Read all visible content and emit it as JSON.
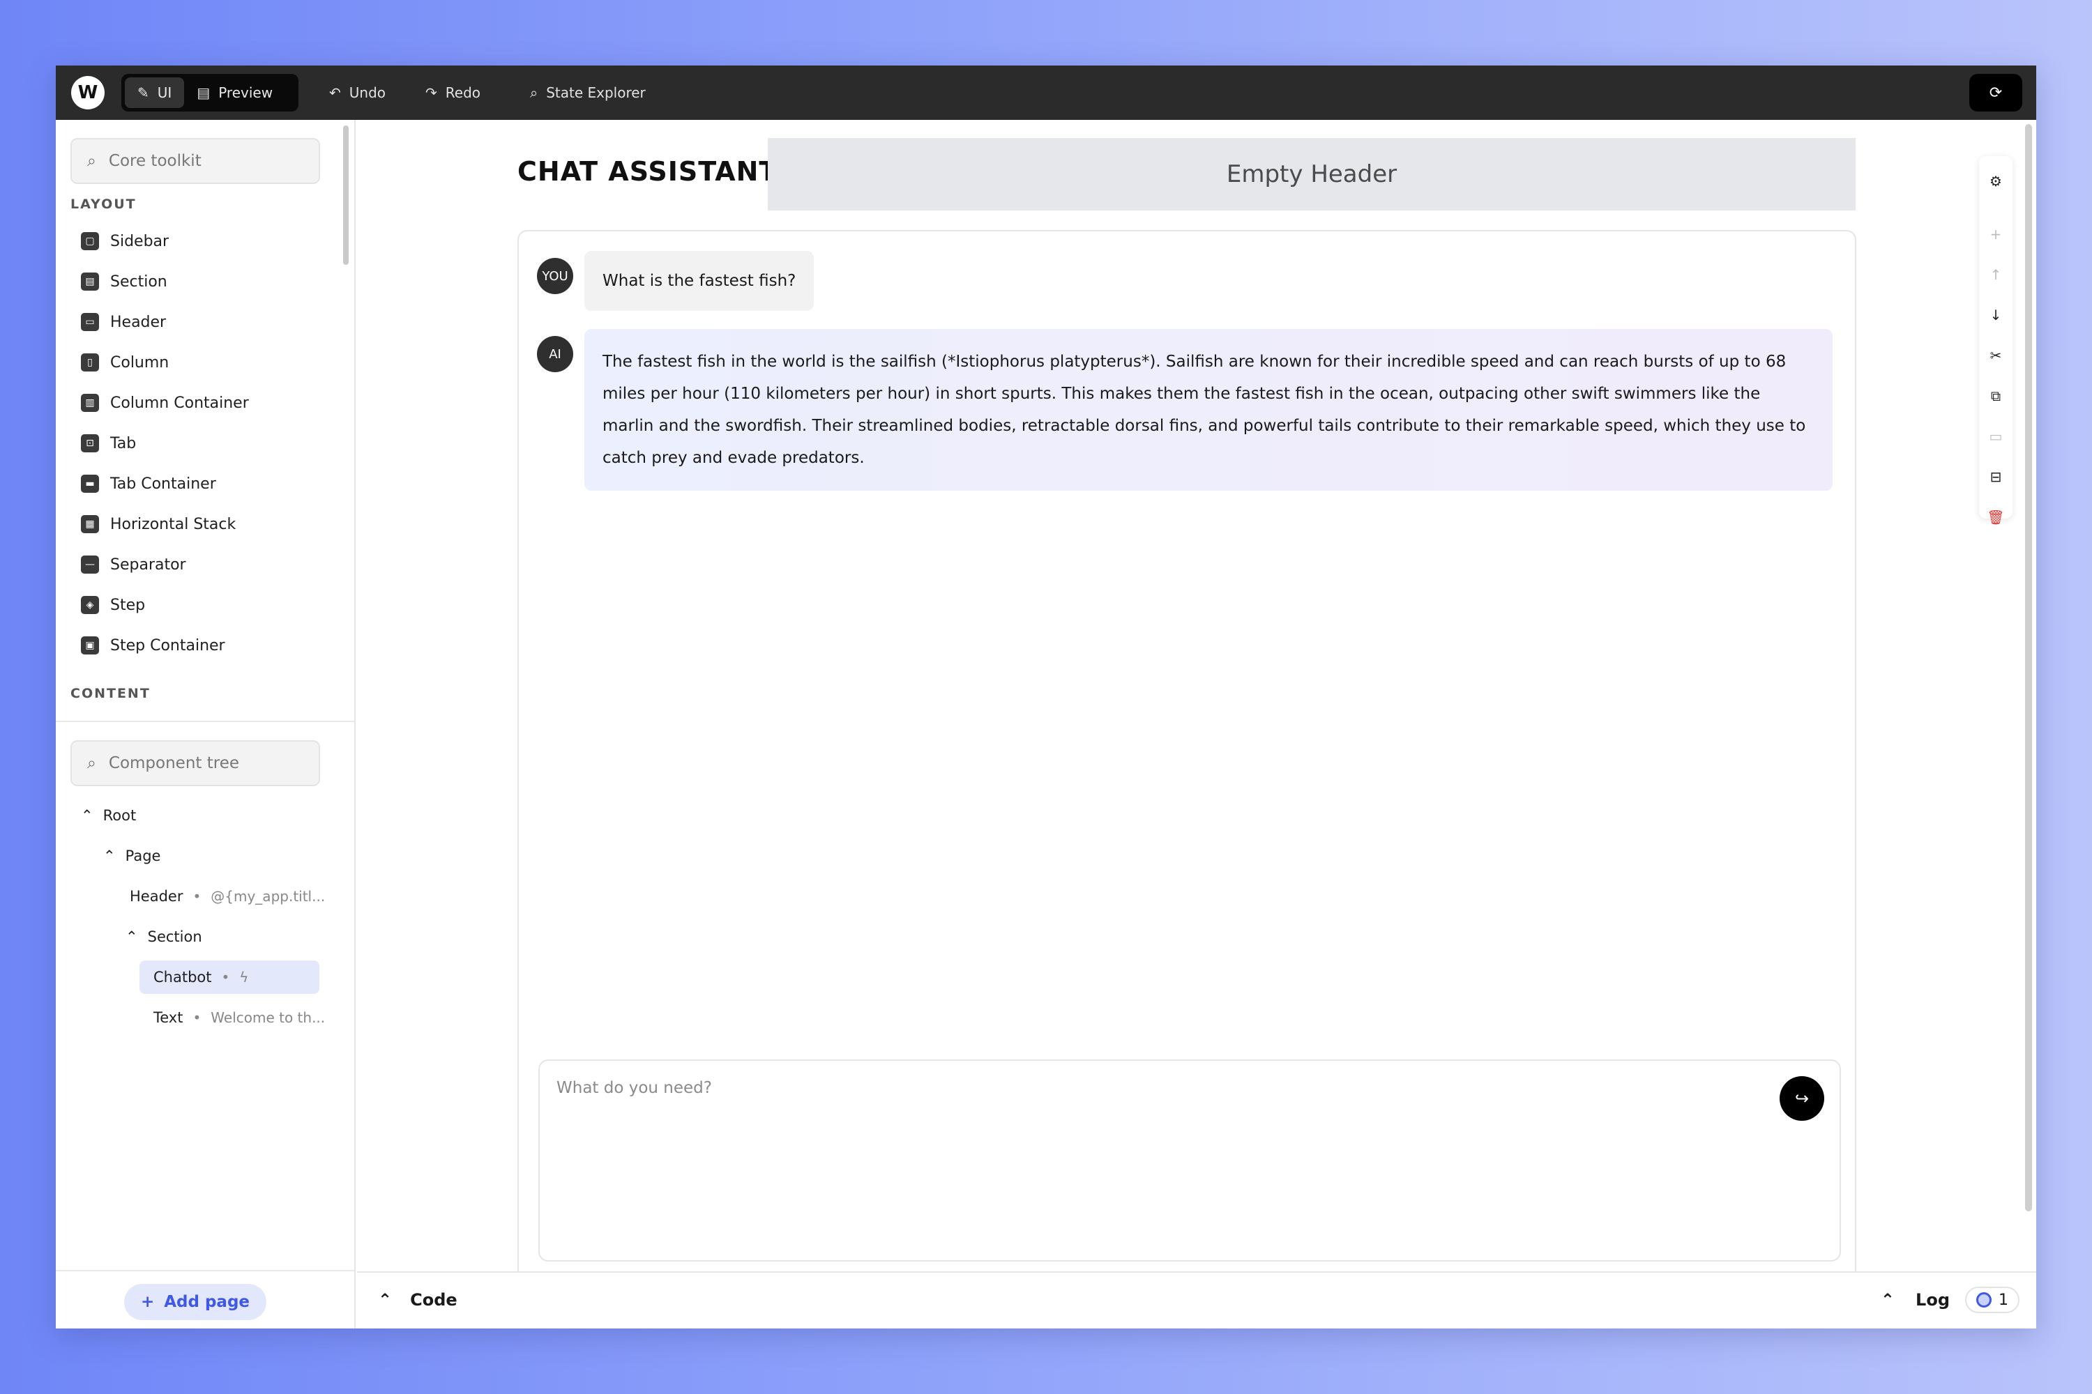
{
  "topbar": {
    "logo": "W",
    "modes": [
      {
        "label": "UI",
        "icon": "pencil-icon",
        "active": true
      },
      {
        "label": "Preview",
        "icon": "preview-icon",
        "active": false
      }
    ],
    "undo_label": "Undo",
    "redo_label": "Redo",
    "state_explorer_label": "State Explorer"
  },
  "sidebar": {
    "toolkit_search_placeholder": "Core toolkit",
    "layout_label": "LAYOUT",
    "layout_items": [
      {
        "label": "Sidebar",
        "icon": "sidebar-icon"
      },
      {
        "label": "Section",
        "icon": "section-icon"
      },
      {
        "label": "Header",
        "icon": "header-icon"
      },
      {
        "label": "Column",
        "icon": "column-icon"
      },
      {
        "label": "Column Container",
        "icon": "column-container-icon"
      },
      {
        "label": "Tab",
        "icon": "tab-icon"
      },
      {
        "label": "Tab Container",
        "icon": "tab-container-icon"
      },
      {
        "label": "Horizontal Stack",
        "icon": "horizontal-stack-icon"
      },
      {
        "label": "Separator",
        "icon": "separator-icon"
      },
      {
        "label": "Step",
        "icon": "step-icon"
      },
      {
        "label": "Step Container",
        "icon": "step-container-icon"
      }
    ],
    "content_label": "CONTENT",
    "tree_search_placeholder": "Component tree",
    "tree": {
      "root": "Root",
      "page": "Page",
      "header": "Header",
      "header_meta": "@{my_app.titl...",
      "section": "Section",
      "chatbot": "Chatbot",
      "text": "Text",
      "text_meta": "Welcome to th..."
    },
    "add_page_label": "Add page"
  },
  "canvas": {
    "page_title": "CHAT ASSISTANT",
    "empty_header": "Empty Header",
    "messages": [
      {
        "role": "YOU",
        "text": "What is the fastest fish?"
      },
      {
        "role": "AI",
        "text": "The fastest fish in the world is the sailfish (*Istiophorus platypterus*). Sailfish are known for their incredible speed and can reach bursts of up to 68 miles per hour (110 kilometers per hour) in short spurts. This makes them the fastest fish in the ocean, outpacing other swift swimmers like the marlin and the swordfish. Their streamlined bodies, retractable dorsal fins, and powerful tails contribute to their remarkable speed, which they use to catch prey and evade predators."
      }
    ],
    "input_placeholder": "What do you need?"
  },
  "bottombar": {
    "code_label": "Code",
    "log_label": "Log",
    "log_count": "1"
  },
  "colors": {
    "accent": "#3f58e6",
    "topbar_bg": "#2b2b2b",
    "selected_bg": "#e3e8fb",
    "danger": "#e53935"
  }
}
